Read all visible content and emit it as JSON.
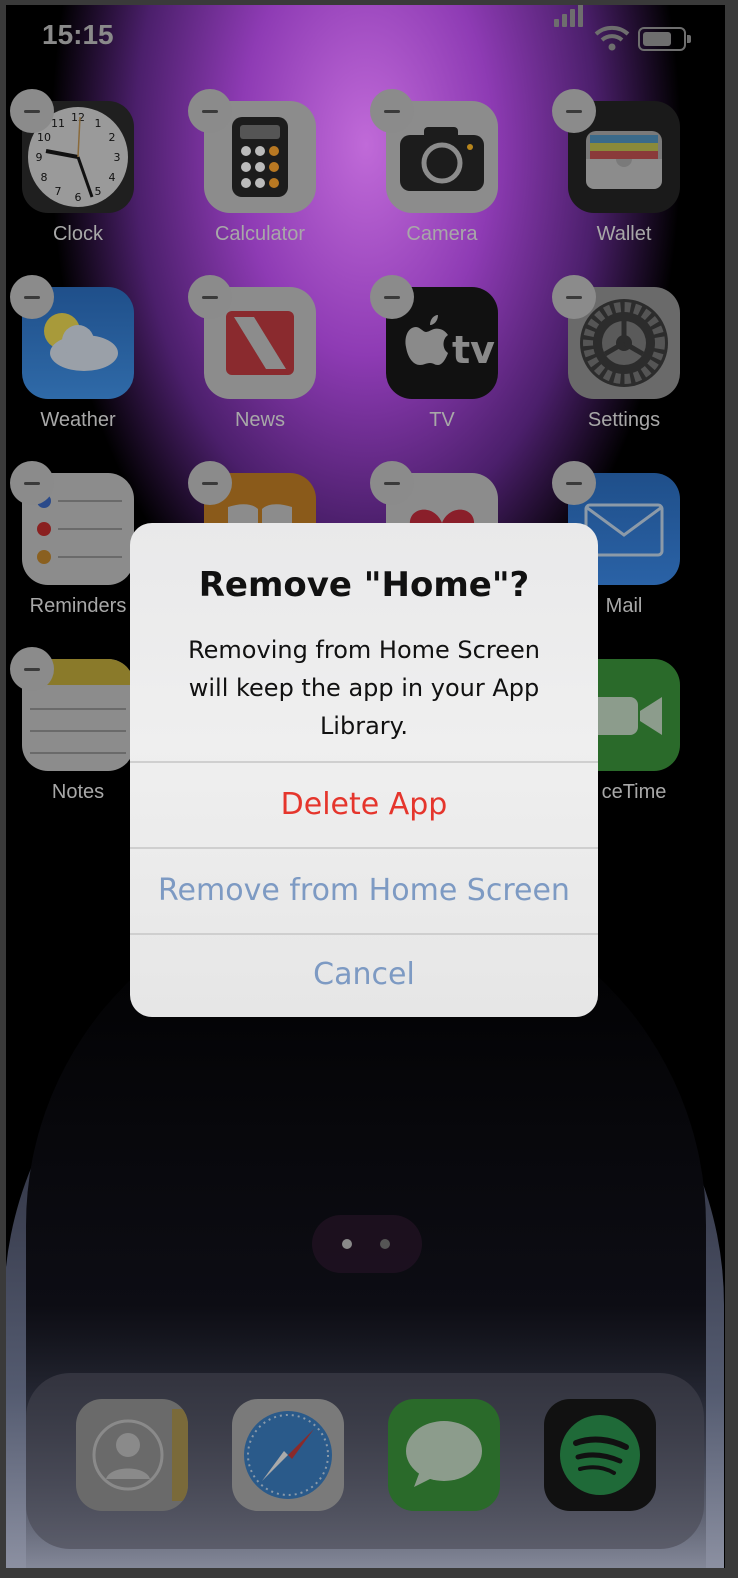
{
  "status_bar": {
    "time": "15:15",
    "icons": [
      "signal-icon",
      "wifi-icon",
      "battery-icon"
    ]
  },
  "home_screen": {
    "apps": [
      {
        "name": "Clock",
        "icon": "clock-icon"
      },
      {
        "name": "Calculator",
        "icon": "calculator-icon"
      },
      {
        "name": "Camera",
        "icon": "camera-icon"
      },
      {
        "name": "Wallet",
        "icon": "wallet-icon"
      },
      {
        "name": "Weather",
        "icon": "weather-icon"
      },
      {
        "name": "News",
        "icon": "news-icon"
      },
      {
        "name": "TV",
        "icon": "tv-icon"
      },
      {
        "name": "Settings",
        "icon": "settings-icon"
      },
      {
        "name": "Reminders",
        "icon": "reminders-icon"
      },
      {
        "name": "",
        "icon": "books-icon"
      },
      {
        "name": "",
        "icon": "health-icon"
      },
      {
        "name": "Mail",
        "icon": "mail-icon"
      },
      {
        "name": "Notes",
        "icon": "notes-icon"
      },
      {
        "name": "ceTime",
        "icon": "facetime-icon"
      }
    ],
    "page_count": 2,
    "current_page": 1
  },
  "dock": {
    "apps": [
      {
        "icon": "contacts-icon"
      },
      {
        "icon": "safari-icon"
      },
      {
        "icon": "messages-icon"
      },
      {
        "icon": "spotify-icon"
      }
    ]
  },
  "alert": {
    "title": "Remove \"Home\"?",
    "message": "Removing from Home Screen will keep the app in your App Library.",
    "buttons": [
      {
        "label": "Delete App",
        "style": "destructive",
        "color": "#e5352c"
      },
      {
        "label": "Remove from Home Screen",
        "style": "default",
        "color": "#7d9ac3"
      },
      {
        "label": "Cancel",
        "style": "cancel",
        "color": "#7d9ac3"
      }
    ]
  },
  "colors": {
    "accent": "#7d9ac3",
    "destructive": "#e5352c",
    "wallpaper": "#8e3bb4"
  }
}
